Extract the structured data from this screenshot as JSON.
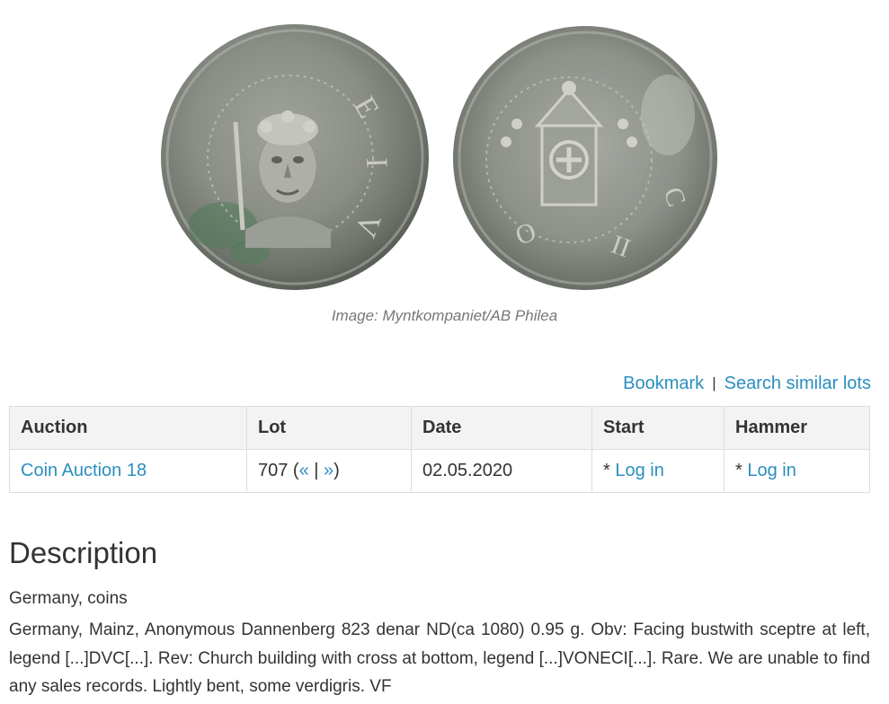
{
  "image": {
    "obverse_alt": "coin-obverse",
    "reverse_alt": "coin-reverse",
    "caption": "Image: Myntkompaniet/AB Philea"
  },
  "actions": {
    "bookmark": "Bookmark",
    "separator": "|",
    "search_similar": "Search similar lots"
  },
  "table": {
    "headers": {
      "auction": "Auction",
      "lot": "Lot",
      "date": "Date",
      "start": "Start",
      "hammer": "Hammer"
    },
    "row": {
      "auction": "Coin Auction 18",
      "lot_number": "707",
      "lot_open": " (",
      "prev": "«",
      "lot_sep": " | ",
      "next": "»",
      "lot_close": ")",
      "date": "02.05.2020",
      "start_prefix": "* ",
      "start_link": "Log in",
      "hammer_prefix": "* ",
      "hammer_link": "Log in"
    }
  },
  "description": {
    "title": "Description",
    "category": "Germany, coins",
    "text": "Germany, Mainz, Anonymous Dannenberg 823 denar ND(ca 1080) 0.95 g. Obv: Facing bustwith scep­tre at left, legend [...]DVC[...]. Rev: Church building with cross at bottom, legend [...]VONECI[...]. Rare. We are unable to find any sales records. Lightly bent, some verdigris. VF"
  },
  "colors": {
    "link": "#2a8fc0",
    "text": "#333333",
    "header_bg": "#f3f3f3",
    "border": "#dddddd",
    "caption": "#777777"
  }
}
